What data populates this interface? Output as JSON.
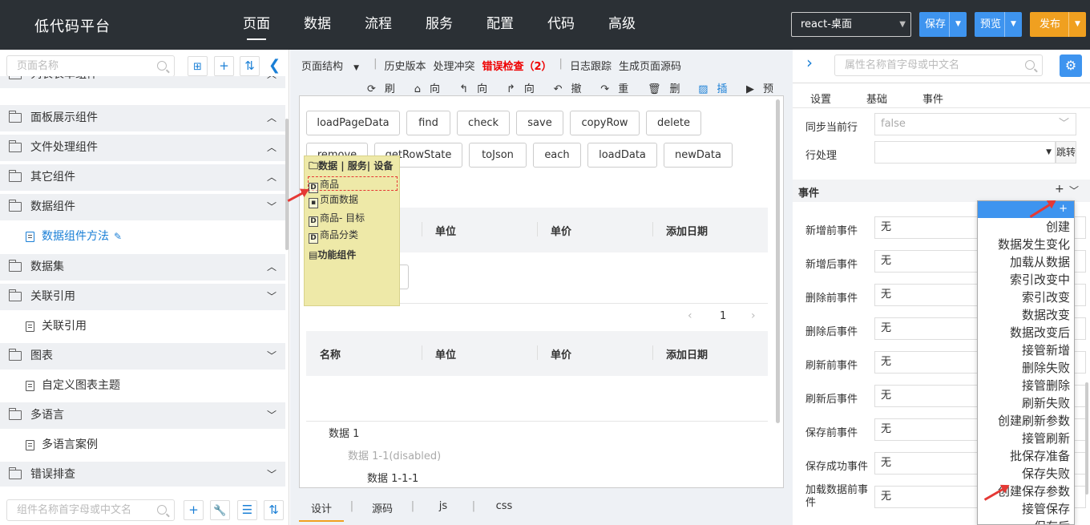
{
  "topbar": {
    "brand": "低代码平台",
    "nav": [
      "页面",
      "数据",
      "流程",
      "服务",
      "配置",
      "代码",
      "高级"
    ],
    "env": "react-桌面",
    "save": "保存",
    "preview": "预览",
    "publish": "发布"
  },
  "colors": {
    "topbar": "#2b3035",
    "save": "#3e94ef",
    "preview": "#3e94ef",
    "publish": "#f0a020",
    "error": "#e00000"
  },
  "left": {
    "search_placeholder": "页面名称",
    "tree": [
      {
        "label": "列表表单组件",
        "type": "group",
        "open": true
      },
      {
        "label": "面板展示组件",
        "type": "group",
        "open": true
      },
      {
        "label": "文件处理组件",
        "type": "group",
        "open": true
      },
      {
        "label": "其它组件",
        "type": "group",
        "open": true
      },
      {
        "label": "数据组件",
        "type": "group",
        "open": false
      },
      {
        "label": "数据组件方法",
        "type": "child",
        "active": true
      },
      {
        "label": "数据集",
        "type": "group",
        "open": true
      },
      {
        "label": "关联引用",
        "type": "group",
        "open": false
      },
      {
        "label": "关联引用",
        "type": "child"
      },
      {
        "label": "图表",
        "type": "group",
        "open": false
      },
      {
        "label": "自定义图表主题",
        "type": "child"
      },
      {
        "label": "多语言",
        "type": "group",
        "open": false
      },
      {
        "label": "多语言案例",
        "type": "child"
      },
      {
        "label": "错误排查",
        "type": "group",
        "open": false
      }
    ],
    "bottom_search_placeholder": "组件名称首字母或中文名"
  },
  "center": {
    "toolbar1": [
      "页面结构",
      "历史版本",
      "处理冲突",
      "错误检查（2）",
      "日志跟踪",
      "生成页面源码"
    ],
    "toolbar2": [
      "刷新",
      "向上",
      "向前",
      "向后",
      "撤销",
      "重做",
      "删除",
      "插图",
      "预览"
    ],
    "method_buttons_row1": [
      "loadPageData",
      "find",
      "check",
      "save",
      "copyRow",
      "delete"
    ],
    "method_buttons_row2": [
      "remove",
      "getRowState",
      "toJson",
      "each",
      "loadData",
      "newData"
    ],
    "table_headers": [
      "名称",
      "单位",
      "单价",
      "添加日期"
    ],
    "pager_page": "1",
    "dropdown": {
      "title": "数据 | 服务| 设备",
      "items": [
        "商品",
        "页面数据",
        "商品- 目标",
        "商品分类"
      ],
      "footer": "功能组件"
    },
    "tree_items": [
      "数据 1",
      "数据 1-1(disabled)",
      "数据 1-1-1"
    ],
    "bottom_tabs": [
      "设计",
      "源码",
      "js",
      "css"
    ]
  },
  "right": {
    "search_placeholder": "属性名称首字母或中文名",
    "tabs": [
      "设置",
      "基础",
      "事件"
    ],
    "sync_label": "同步当前行",
    "sync_value": "false",
    "row_label": "行处理",
    "jump": "跳转",
    "events_title": "事件",
    "add": "+",
    "event_rows": [
      "新增前事件",
      "新增后事件",
      "删除前事件",
      "删除后事件",
      "刷新前事件",
      "刷新后事件",
      "保存前事件",
      "保存成功事件",
      "加载数据前事件"
    ],
    "none": "无",
    "popup_add": "+",
    "popup_items": [
      "创建",
      "数据发生变化",
      "加载从数据",
      "索引改变中",
      "索引改变",
      "数据改变",
      "数据改变后",
      "接管新增",
      "删除失败",
      "接管删除",
      "刷新失败",
      "创建刷新参数",
      "接管刷新",
      "批保存准备",
      "保存失败",
      "创建保存参数",
      "接管保存",
      "保存后"
    ]
  }
}
